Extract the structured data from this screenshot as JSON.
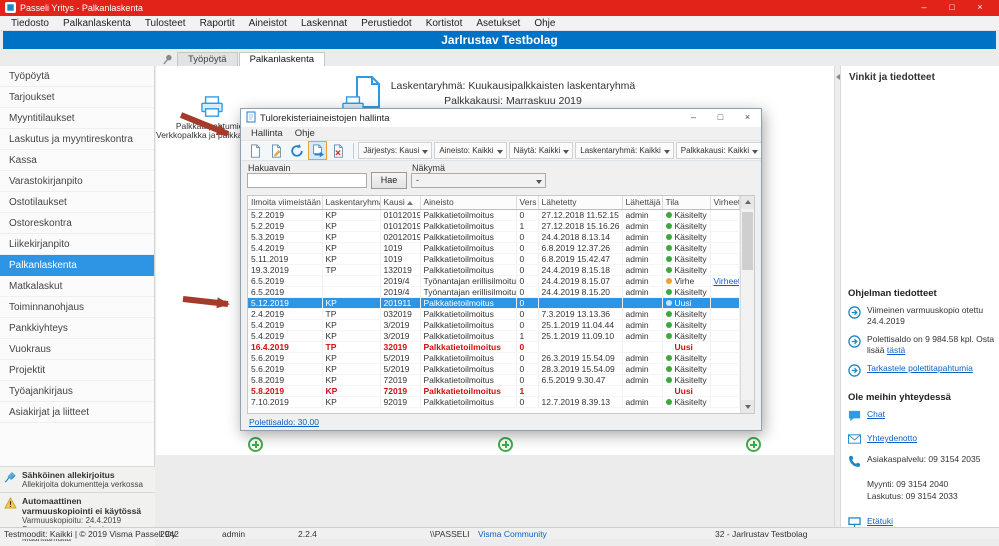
{
  "colors": {
    "titlebar_red": "#E2231A",
    "banner_blue": "#0072C6",
    "selection_blue": "#2E95E5",
    "link_blue": "#0B61C9",
    "status_green": "#3DA93D",
    "status_orange": "#F0A030",
    "error_red": "#CF1010",
    "plus_green": "#3FAE49",
    "annotation_arrow_red": "#A5392A"
  },
  "icons": {
    "app-icon": "blue-square",
    "pin-icon": "pushpin",
    "document-icon": "outlined-document",
    "printer-icon": "printer",
    "new-document-icon": "document",
    "edit-document-icon": "document-pencil",
    "refresh-icon": "circular-arrow",
    "send-material-icon": "document-arrow",
    "delete-icon": "document-x",
    "notice-icon": "circle-arrow",
    "chat-icon": "speech-bubble",
    "mail-icon": "envelope",
    "phone-icon": "handset",
    "remote-icon": "monitor",
    "esign-icon": "pen",
    "warning-icon": "warning-triangle",
    "plus-icon": "circled-plus",
    "annotation-arrow": "red-arrow"
  },
  "titlebar": {
    "title": "Passeli Yritys - Palkanlaskenta",
    "controls": {
      "minimize": "–",
      "maximize": "□",
      "close": "×"
    }
  },
  "menubar": {
    "items": [
      "Tiedosto",
      "Palkanlaskenta",
      "Tulosteet",
      "Raportit",
      "Aineistot",
      "Laskennat",
      "Perustiedot",
      "Kortistot",
      "Asetukset",
      "Ohje"
    ]
  },
  "banner": {
    "company": "Jarlrustav Testbolag"
  },
  "tabs": [
    {
      "label": "Työpöytä"
    },
    {
      "label": "Palkanlaskenta",
      "active": true
    }
  ],
  "sidebar": {
    "items": [
      {
        "label": "Työpöytä"
      },
      {
        "label": "Tarjoukset"
      },
      {
        "label": "Myyntitilaukset"
      },
      {
        "label": "Laskutus ja myyntireskontra"
      },
      {
        "label": "Kassa"
      },
      {
        "label": "Varastokirjanpito"
      },
      {
        "label": "Ostotilaukset"
      },
      {
        "label": "Ostoreskontra"
      },
      {
        "label": "Liikekirjanpito"
      },
      {
        "label": "Palkanlaskenta",
        "selected": true
      },
      {
        "label": "Matkalaskut"
      },
      {
        "label": "Toiminnanohjaus"
      },
      {
        "label": "Pankkiyhteys"
      },
      {
        "label": "Vuokraus"
      },
      {
        "label": "Projektit"
      },
      {
        "label": "Työajankirjaus"
      },
      {
        "label": "Asiakirjat ja liitteet"
      }
    ],
    "footer": {
      "esign_title": "Sähköinen allekirjoitus",
      "esign_text": "Allekirjoita dokumentteja verkossa",
      "backup_title": "Automaattinen varmuuskopiointi ei käytössä",
      "backup_line1": "Varmuuskopioitu: 24.4.2019",
      "backup_line2": "Seuraava varmuuskopio: Määrittämättä"
    }
  },
  "main": {
    "header_line1": "Laskentaryhmä: Kuukausipalkkaisten laskentaryhmä",
    "header_line2": "Palkkakausi: Marraskuu 2019",
    "shortcut1": "Palkkatapahtumien",
    "shortcut2": "Verkkopalkka ja palkkalaske..."
  },
  "dialog": {
    "title": "Tulorekisteriaineistojen hallinta",
    "controls": {
      "minimize": "–",
      "maximize": "□",
      "close": "×"
    },
    "menu": [
      "Hallinta",
      "Ohje"
    ],
    "toolbar": {
      "filters": [
        {
          "label": "Järjestys: Kausi"
        },
        {
          "label": "Aineisto: Kaikki"
        },
        {
          "label": "Näytä: Kaikki"
        },
        {
          "label": "Laskentaryhmä: Kaikki"
        },
        {
          "label": "Palkkakausi: Kaikki"
        }
      ]
    },
    "search": {
      "label": "Hakuavain",
      "value": "",
      "button": "Hae",
      "view_label": "Näkymä",
      "view_value": "-"
    },
    "table": {
      "columns": [
        {
          "label": "Ilmoita viimeistään"
        },
        {
          "label": "Laskentaryhmä"
        },
        {
          "label": "Kausi",
          "sort": true
        },
        {
          "label": "Aineisto"
        },
        {
          "label": "Vers"
        },
        {
          "label": "Lähetetty"
        },
        {
          "label": "Lähettäjä"
        },
        {
          "label": "Tila"
        },
        {
          "label": "Virheet"
        }
      ],
      "rows": [
        {
          "deadline": "5.2.2019",
          "group": "KP",
          "period": "01012019",
          "material": "Palkkatietoilmoitus",
          "version": "0",
          "sent": "27.12.2018 11.52.15",
          "sender": "admin",
          "status": "Käsitelty",
          "dot": "#3DA93D"
        },
        {
          "deadline": "5.2.2019",
          "group": "KP",
          "period": "01012019",
          "material": "Palkkatietoilmoitus",
          "version": "1",
          "sent": "27.12.2018 15.16.26",
          "sender": "admin",
          "status": "Käsitelty",
          "dot": "#3DA93D"
        },
        {
          "deadline": "5.3.2019",
          "group": "KP",
          "period": "02012019",
          "material": "Palkkatietoilmoitus",
          "version": "0",
          "sent": "24.4.2018 8.13.14",
          "sender": "admin",
          "status": "Käsitelty",
          "dot": "#3DA93D"
        },
        {
          "deadline": "5.4.2019",
          "group": "KP",
          "period": "1019",
          "material": "Palkkatietoilmoitus",
          "version": "0",
          "sent": "6.8.2019 12.37.26",
          "sender": "admin",
          "status": "Käsitelty",
          "dot": "#3DA93D"
        },
        {
          "deadline": "5.11.2019",
          "group": "KP",
          "period": "1019",
          "material": "Palkkatietoilmoitus",
          "version": "0",
          "sent": "6.8.2019 15.42.47",
          "sender": "admin",
          "status": "Käsitelty",
          "dot": "#3DA93D"
        },
        {
          "deadline": "19.3.2019",
          "group": "TP",
          "period": "132019",
          "material": "Palkkatietoilmoitus",
          "version": "0",
          "sent": "24.4.2019 8.15.18",
          "sender": "admin",
          "status": "Käsitelty",
          "dot": "#3DA93D"
        },
        {
          "deadline": "6.5.2019",
          "period": "2019/4",
          "material": "Työnantajan erillisilmoitus",
          "version": "0",
          "sent": "24.4.2019 8.15.07",
          "sender": "admin",
          "status": "Virhe",
          "dot": "#F0A030",
          "errors": "Virheet"
        },
        {
          "deadline": "6.5.2019",
          "period": "2019/4",
          "material": "Työnantajan erillisilmoitus",
          "version": "0",
          "sent": "24.4.2019 8.15.20",
          "sender": "admin",
          "status": "Käsitelty",
          "dot": "#3DA93D"
        },
        {
          "deadline": "5.12.2019",
          "group": "KP",
          "period": "201911",
          "material": "Palkkatietoilmoitus",
          "version": "0",
          "status": "Uusi",
          "dot": "#BFE6FF",
          "selected": true
        },
        {
          "deadline": "2.4.2019",
          "group": "TP",
          "period": "032019",
          "material": "Palkkatietoilmoitus",
          "version": "0",
          "sent": "7.3.2019 13.13.36",
          "sender": "admin",
          "status": "Käsitelty",
          "dot": "#3DA93D"
        },
        {
          "deadline": "5.4.2019",
          "group": "KP",
          "period": "3/2019",
          "material": "Palkkatietoilmoitus",
          "version": "0",
          "sent": "25.1.2019 11.04.44",
          "sender": "admin",
          "status": "Käsitelty",
          "dot": "#3DA93D"
        },
        {
          "deadline": "5.4.2019",
          "group": "KP",
          "period": "3/2019",
          "material": "Palkkatietoilmoitus",
          "version": "1",
          "sent": "25.1.2019 11.09.10",
          "sender": "admin",
          "status": "Käsitelty",
          "dot": "#3DA93D"
        },
        {
          "deadline": "16.4.2019",
          "group": "TP",
          "period": "32019",
          "material": "Palkkatietoilmoitus",
          "version": "0",
          "status": "Uusi",
          "red": true
        },
        {
          "deadline": "5.6.2019",
          "group": "KP",
          "period": "5/2019",
          "material": "Palkkatietoilmoitus",
          "version": "0",
          "sent": "26.3.2019 15.54.09",
          "sender": "admin",
          "status": "Käsitelty",
          "dot": "#3DA93D"
        },
        {
          "deadline": "5.6.2019",
          "group": "KP",
          "period": "5/2019",
          "material": "Palkkatietoilmoitus",
          "version": "0",
          "sent": "28.3.2019 15.54.09",
          "sender": "admin",
          "status": "Käsitelty",
          "dot": "#3DA93D"
        },
        {
          "deadline": "5.8.2019",
          "group": "KP",
          "period": "72019",
          "material": "Palkkatietoilmoitus",
          "version": "0",
          "sent": "6.5.2019 9.30.47",
          "sender": "admin",
          "status": "Käsitelty",
          "dot": "#3DA93D"
        },
        {
          "deadline": "5.8.2019",
          "group": "KP",
          "period": "72019",
          "material": "Palkkatietoilmoitus",
          "version": "1",
          "status": "Uusi",
          "red": true
        },
        {
          "deadline": "7.10.2019",
          "group": "KP",
          "period": "92019",
          "material": "Palkkatietoilmoitus",
          "version": "0",
          "sent": "12.7.2019 8.39.13",
          "sender": "admin",
          "status": "Käsitelty",
          "dot": "#3DA93D"
        }
      ]
    },
    "footer_link": "Polettisaldo: 30.00"
  },
  "right_panel": {
    "title": "Vinkit ja tiedotteet",
    "program_header": "Ohjelman  tiedotteet",
    "backup_notice": "Viimeinen varmuuskopio otettu 24.4.2019",
    "poletti_text": "Polettisaldo on 9 984.58 kpl. Osta lisää",
    "poletti_link": "tästä",
    "poletti_view_link": "Tarkastele polettitapahtumia",
    "contact_header": "Ole meihin  yhteydessä",
    "chat_link": "Chat",
    "contact_link": "Yhteydenotto",
    "phone_line1": "Asiakaspalvelu: 09 3154 2035",
    "phone_line2": "Myynti: 09 3154 2040",
    "phone_line3": "Laskutus: 09 3154 2033",
    "remote_link": "Etätuki"
  },
  "statusbar": {
    "left": "Testmoodit: Kaikki | © 2019 Visma Passeli Oy",
    "item1": "2942",
    "item2": "admin",
    "item3": "2.2.4",
    "item4": "\\\\PASSELI",
    "community_link": "Visma Community",
    "right": "32 - Jarlrustav Testbolag"
  }
}
